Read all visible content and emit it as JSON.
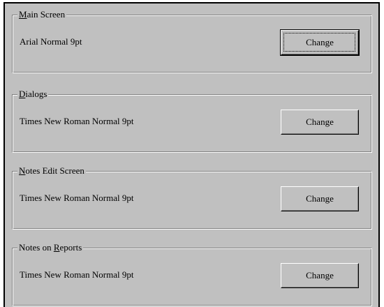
{
  "groups": [
    {
      "title_accel": "M",
      "title_rest": "ain Screen",
      "font": "Arial Normal 9pt",
      "button_label": "Change"
    },
    {
      "title_accel": "D",
      "title_rest": "ialogs",
      "font": "Times New Roman Normal 9pt",
      "button_label": "Change"
    },
    {
      "title_accel": "N",
      "title_rest": "otes Edit Screen",
      "font": "Times New Roman Normal 9pt",
      "button_label": "Change"
    },
    {
      "title_prefix": "Notes on ",
      "title_accel": "R",
      "title_rest": "eports",
      "font": "Times New Roman Normal 9pt",
      "button_label": "Change"
    }
  ]
}
